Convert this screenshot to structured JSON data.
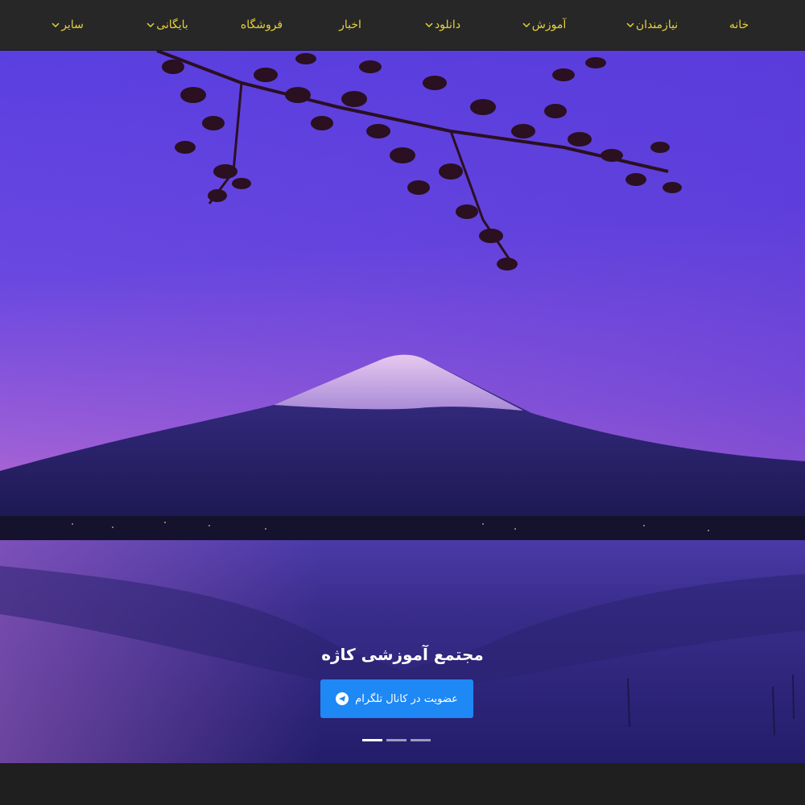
{
  "nav": {
    "items": [
      {
        "label": "خانه",
        "has_dropdown": false
      },
      {
        "label": "نیازمندان",
        "has_dropdown": true
      },
      {
        "label": "آموزش",
        "has_dropdown": true
      },
      {
        "label": "دانلود",
        "has_dropdown": true
      },
      {
        "label": "اخبار",
        "has_dropdown": false
      },
      {
        "label": "فروشگاه",
        "has_dropdown": false
      },
      {
        "label": "بایگانی",
        "has_dropdown": true
      },
      {
        "label": "سایر",
        "has_dropdown": true
      }
    ],
    "text_color": "#e8d23a",
    "background": "#262726"
  },
  "hero": {
    "title": "مجتمع آموزشی کاژه",
    "cta_label": "عضویت در کانال تلگرام",
    "cta_icon": "telegram-icon",
    "cta_color": "#1e88f5",
    "slide_count": 3,
    "active_slide": 1,
    "image": "mountain-lake-twilight"
  }
}
